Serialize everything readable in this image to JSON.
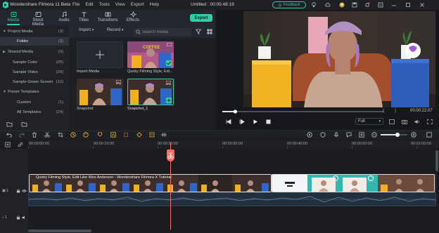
{
  "titlebar": {
    "app_name": "Wondershare Filmora 11 Beta",
    "menu": [
      "File",
      "Edit",
      "Tools",
      "View",
      "Export",
      "Help"
    ],
    "document": "Untitled : 00:05:48:19",
    "feedback": "Feedback"
  },
  "tabs": [
    {
      "label": "Media",
      "icon": "media-icon"
    },
    {
      "label": "Stock Media",
      "icon": "stock-media-icon"
    },
    {
      "label": "Audio",
      "icon": "music-icon"
    },
    {
      "label": "Titles",
      "icon": "titles-icon"
    },
    {
      "label": "Transitions",
      "icon": "transitions-icon"
    },
    {
      "label": "Effects",
      "icon": "effects-icon"
    }
  ],
  "export_label": "Export",
  "sidebar": [
    {
      "label": "Project Media",
      "count": "(3)",
      "arrow": "▼",
      "level": 0
    },
    {
      "label": "Folder",
      "count": "(3)",
      "level": 1,
      "selected": true
    },
    {
      "label": "Shared Media",
      "count": "(0)",
      "arrow": "▶",
      "level": 0
    },
    {
      "label": "Sample Color",
      "count": "(25)",
      "level": 1
    },
    {
      "label": "Sample Video",
      "count": "(20)",
      "level": 1
    },
    {
      "label": "Sample Green Screen",
      "count": "(10)",
      "level": 1
    },
    {
      "label": "Preset Templates",
      "count": "",
      "arrow": "▼",
      "level": 0
    },
    {
      "label": "Custom",
      "count": "(1)",
      "level": 2
    },
    {
      "label": "All Templates",
      "count": "(24)",
      "level": 2
    }
  ],
  "media_toolbar": {
    "import": "Import",
    "record": "Record",
    "search_placeholder": "Search media"
  },
  "media_items": [
    {
      "label": "Import Media"
    },
    {
      "label": "Quirky Filming Style, Edi..."
    },
    {
      "label": "Snapshot"
    },
    {
      "label": "Snapshot_1"
    }
  ],
  "preview": {
    "timecode": "00:00:22:07",
    "quality": "Full",
    "progress": 0.08,
    "bracket_left": "{",
    "bracket_right": "}"
  },
  "timeline": {
    "ruler": [
      "00:00:00:00",
      "00:00:10:00",
      "00:00:20:00",
      "00:00:30:00",
      "00:00:40:00",
      "00:00:50:00",
      "00:01:00:00"
    ],
    "clip1_title": "Quirky Filming Style, Edit Like Wes Anderson - Wondershare Filmora X Tutorial",
    "track_labels": {
      "video": "1",
      "audio": "1"
    }
  },
  "colors": {
    "accent": "#2fd0a6",
    "playhead": "#ff6a5e"
  }
}
